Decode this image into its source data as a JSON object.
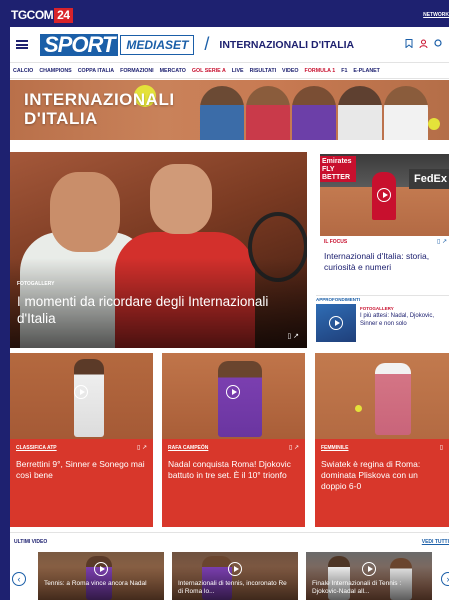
{
  "topbar": {
    "brand_a": "TGCOM",
    "brand_b": "24",
    "network": "NETWORK"
  },
  "header": {
    "logo_sport": "SPORT",
    "logo_mediaset": "MEDIASET",
    "separator": "/",
    "section_title": "INTERNAZIONALI D'ITALIA"
  },
  "nav": {
    "items": [
      "CALCIO",
      "CHAMPIONS",
      "COPPA ITALIA",
      "FORMAZIONI",
      "MERCATO",
      "GOL SERIE A",
      "LIVE",
      "RISULTATI",
      "VIDEO",
      "FORMULA 1",
      "F1",
      "E-PLANET"
    ]
  },
  "banner": {
    "title_line1": "INTERNAZIONALI",
    "title_line2": "D'ITALIA"
  },
  "hero": {
    "tag": "FOTOGALLERY",
    "title": "I momenti da ricordare degli Internazionali d'Italia"
  },
  "side": {
    "ad_left": "Emirates FLY BETTER",
    "ad_right": "FedEx",
    "tag": "IL FOCUS",
    "title": "Internazionali d'Italia: storia, curiosità e numeri"
  },
  "approfondimenti": {
    "label": "APPROFONDIMENTI",
    "tag": "FOTOGALLERY",
    "title": "I più attesi: Nadal, Djokovic, Sinner e non solo"
  },
  "cards": [
    {
      "tag": "CLASSIFICA ATP",
      "title": "Berrettini 9°, Sinner e Sonego mai così bene"
    },
    {
      "tag": "RAFA CAMPEÓN",
      "title": "Nadal conquista Roma! Djokovic battuto in tre set. È il 10° trionfo"
    },
    {
      "tag": "FEMMINILE",
      "title": "Swiatek è regina di Roma: dominata Pliskova con un doppio 6-0"
    }
  ],
  "latest_videos": {
    "title": "ULTIMI VIDEO",
    "see_all": "VEDI TUTTI",
    "items": [
      {
        "title": "Tennis: a Roma vince ancora Nadal"
      },
      {
        "title": "Internazionali di tennis, incoronato Re di Roma lo..."
      },
      {
        "title": "Finale Internazionali di Tennis : Djokovic-Nadal all..."
      }
    ]
  },
  "colors": {
    "navy": "#1e2170",
    "brand_blue": "#1b5fa8",
    "red": "#d8372b"
  }
}
